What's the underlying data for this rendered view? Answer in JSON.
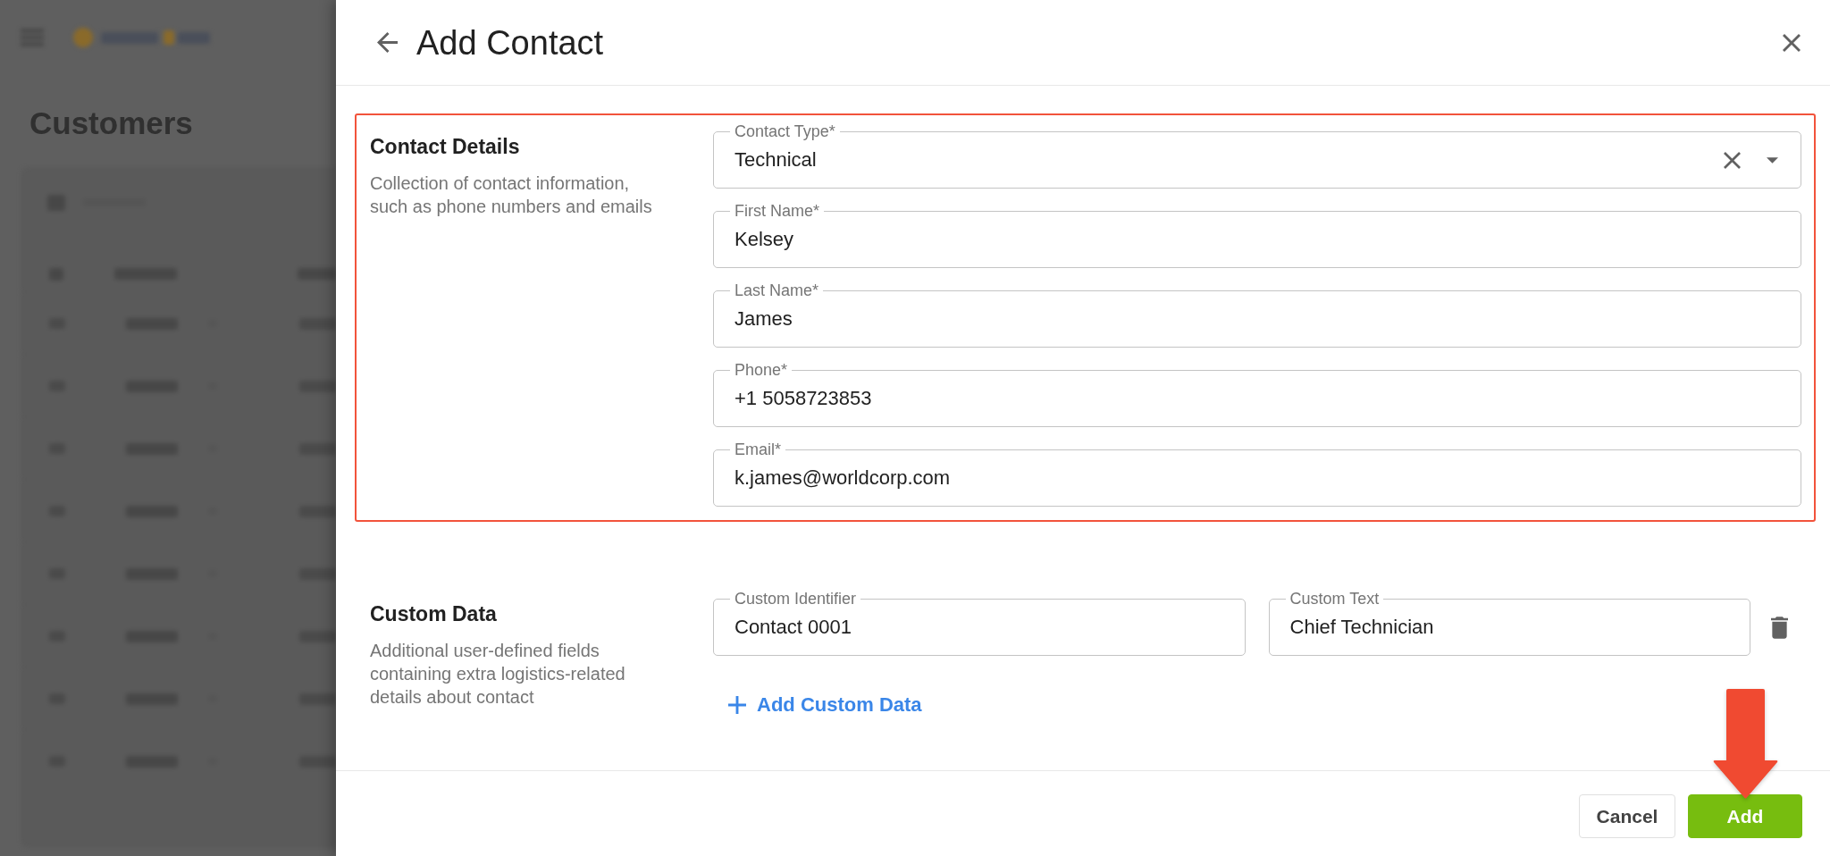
{
  "background_page": {
    "title": "Customers"
  },
  "drawer": {
    "title": "Add Contact"
  },
  "sections": [
    {
      "kind": "contact",
      "title": "Contact Details",
      "description": "Collection of contact information, such as phone numbers and emails",
      "highlighted": true,
      "fields": [
        {
          "kind": "select",
          "label": "Contact Type*",
          "value": "Technical"
        },
        {
          "kind": "text",
          "label": "First Name*",
          "value": "Kelsey"
        },
        {
          "kind": "text",
          "label": "Last Name*",
          "value": "James"
        },
        {
          "kind": "text",
          "label": "Phone*",
          "value": "+1 5058723853"
        },
        {
          "kind": "text",
          "label": "Email*",
          "value": "k.james@worldcorp.com"
        }
      ]
    },
    {
      "kind": "custom",
      "title": "Custom Data",
      "description": "Additional user-defined fields containing extra logistics-related details about contact",
      "highlighted": false,
      "rows": [
        {
          "fields": [
            {
              "kind": "text",
              "label": "Custom Identifier",
              "value": "Contact 0001"
            },
            {
              "kind": "text",
              "label": "Custom Text",
              "value": "Chief Technician"
            }
          ]
        }
      ],
      "add_link": "Add Custom Data"
    }
  ],
  "footer": {
    "buttons": [
      {
        "kind": "secondary",
        "label": "Cancel",
        "pointed": false
      },
      {
        "kind": "primary",
        "label": "Add",
        "pointed": true
      }
    ]
  }
}
